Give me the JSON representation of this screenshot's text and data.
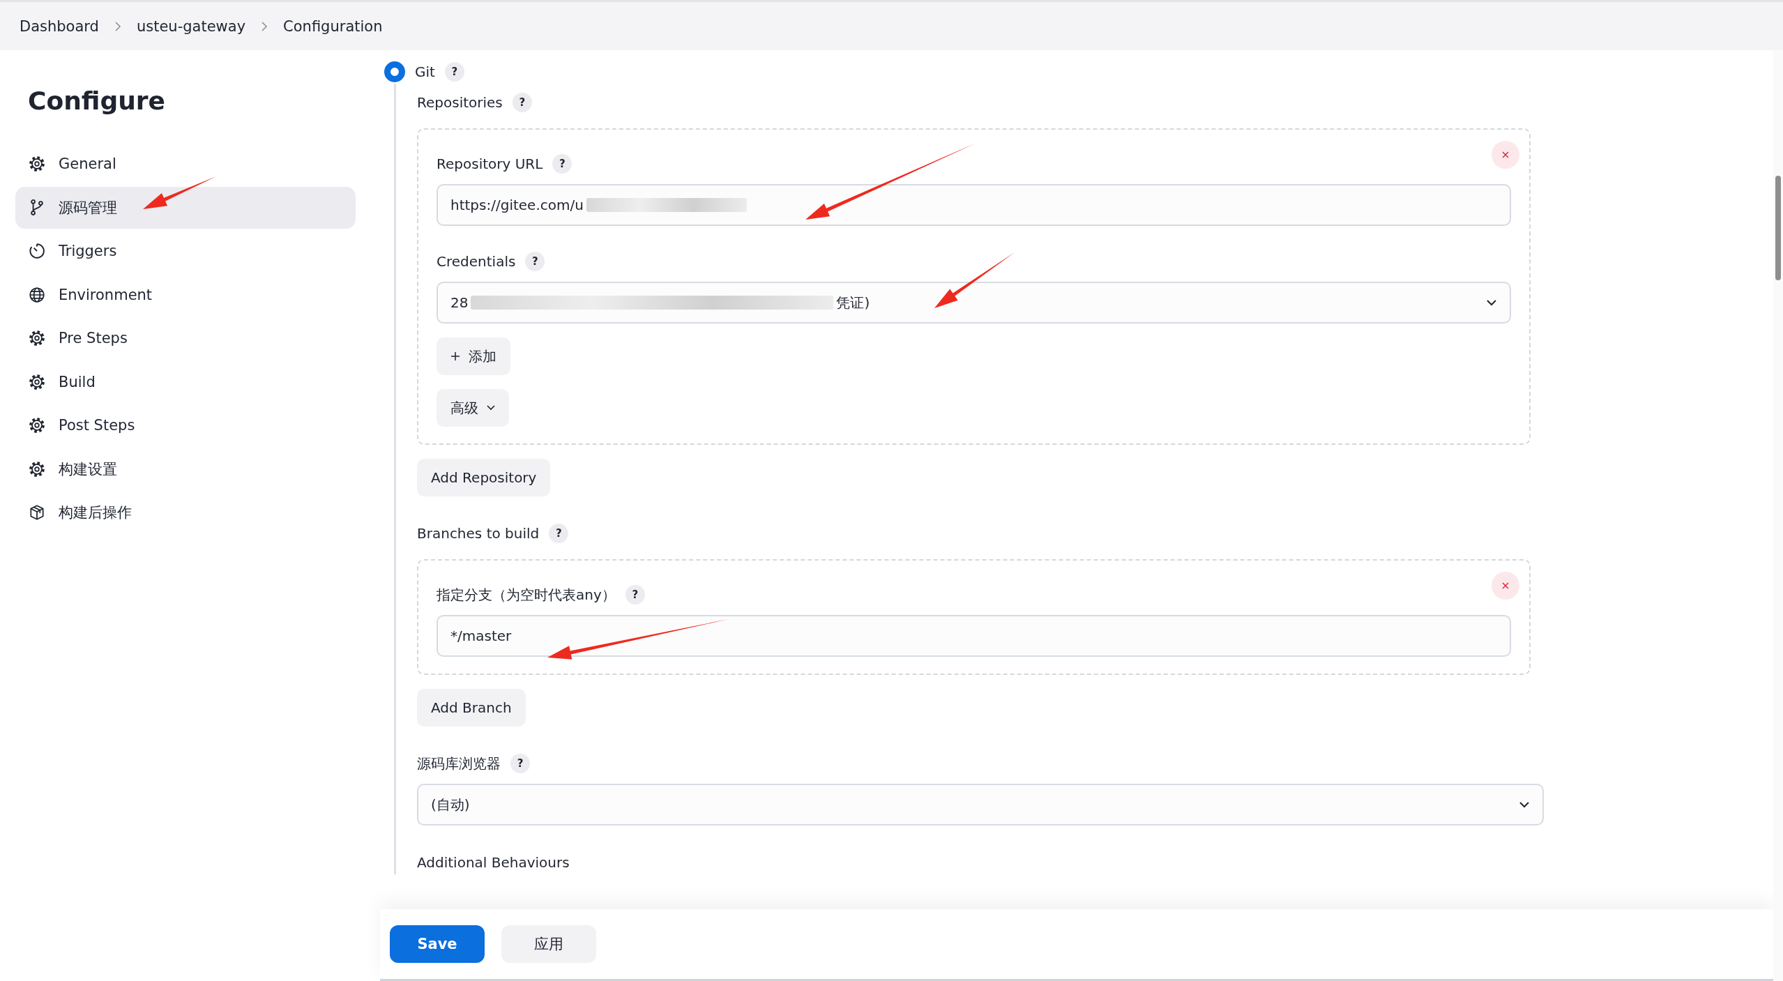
{
  "breadcrumb": [
    {
      "label": "Dashboard"
    },
    {
      "label": "usteu-gateway"
    },
    {
      "label": "Configuration"
    }
  ],
  "sidebar": {
    "title": "Configure",
    "items": [
      {
        "label": "General",
        "kind": "gear",
        "selected": false
      },
      {
        "label": "源码管理",
        "kind": "branch",
        "selected": true
      },
      {
        "label": "Triggers",
        "kind": "timer",
        "selected": false
      },
      {
        "label": "Environment",
        "kind": "globe",
        "selected": false
      },
      {
        "label": "Pre Steps",
        "kind": "gear",
        "selected": false
      },
      {
        "label": "Build",
        "kind": "gear",
        "selected": false
      },
      {
        "label": "Post Steps",
        "kind": "gear",
        "selected": false
      },
      {
        "label": "构建设置",
        "kind": "gear",
        "selected": false
      },
      {
        "label": "构建后操作",
        "kind": "package",
        "selected": false
      }
    ]
  },
  "scm": {
    "option": {
      "label": "Git",
      "help": "?",
      "selected": true
    },
    "repositories": {
      "label": "Repositories",
      "help": "?"
    },
    "repository": {
      "url": {
        "label": "Repository URL",
        "help": "?",
        "value": "https://gitee.com/u"
      },
      "credentials": {
        "label": "Credentials",
        "help": "?",
        "value_start": "28",
        "value_end": "凭证)"
      },
      "add_button": "添加",
      "advanced_button": "高级"
    },
    "add_repository": "Add Repository",
    "branches": {
      "label": "Branches to build",
      "help": "?"
    },
    "branch": {
      "label": "指定分支（为空时代表any）",
      "help": "?",
      "value": "*/master"
    },
    "add_branch": "Add Branch",
    "browser": {
      "label": "源码库浏览器",
      "help": "?",
      "value": "(自动)"
    },
    "additional": {
      "label": "Additional Behaviours"
    }
  },
  "actions": {
    "save": "Save",
    "apply": "应用"
  }
}
